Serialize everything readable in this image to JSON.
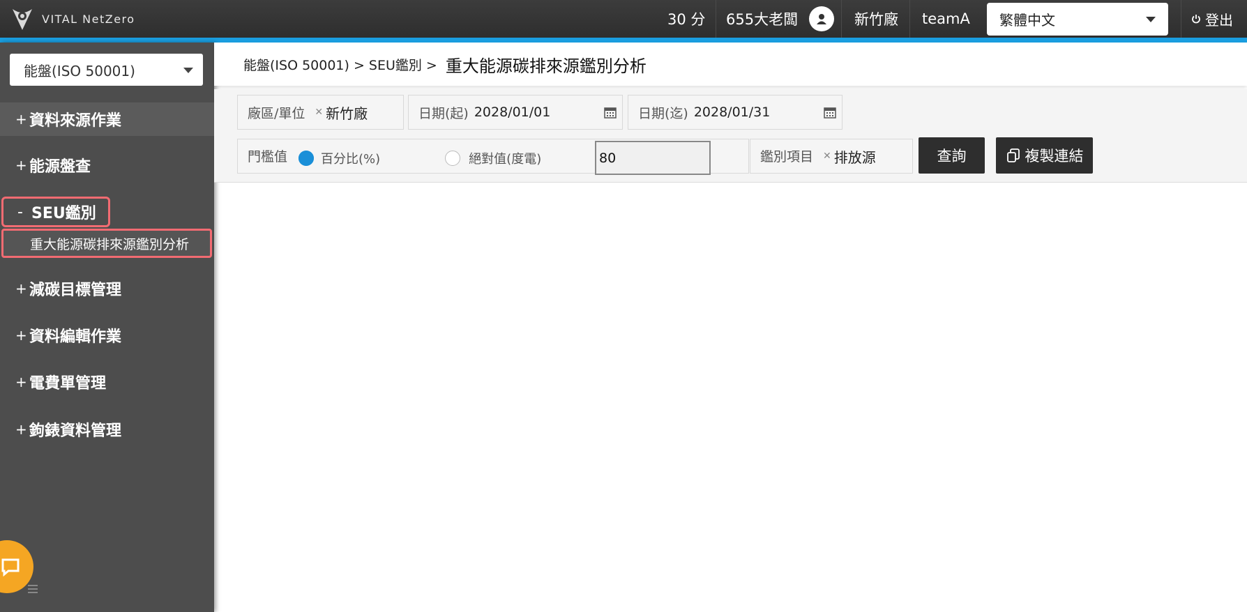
{
  "header": {
    "logo_text": "VITAL NetZero",
    "points": "30 分",
    "username": "655大老闆",
    "plant": "新竹廠",
    "team": "teamA",
    "language": "繁體中文",
    "logout_label": "登出"
  },
  "sidebar": {
    "module": "能盤(ISO 50001)",
    "items": [
      {
        "sign": "+",
        "label": "資料來源作業"
      },
      {
        "sign": "+",
        "label": "能源盤查"
      },
      {
        "sign": "-",
        "label": "SEU鑑別"
      },
      {
        "sign": "+",
        "label": "減碳目標管理"
      },
      {
        "sign": "+",
        "label": "資料編輯作業"
      },
      {
        "sign": "+",
        "label": "電費單管理"
      },
      {
        "sign": "+",
        "label": "鉤錶資料管理"
      }
    ],
    "sub_item": "重大能源碳排來源鑑別分析"
  },
  "breadcrumb": {
    "path": "能盤(ISO 50001) > SEU鑑別 >",
    "title": "重大能源碳排來源鑑別分析"
  },
  "filters": {
    "plant_label": "廠區/單位",
    "plant_value": "新竹廠",
    "date_start_label": "日期(起)",
    "date_start_value": "2028/01/01",
    "date_end_label": "日期(迄)",
    "date_end_value": "2028/01/31",
    "threshold_label": "門檻值",
    "radio_percent": "百分比(%)",
    "radio_absolute": "絕對值(度電)",
    "threshold_value": "80",
    "item_label": "鑑別項目",
    "item_value": "排放源",
    "query_label": "查詢",
    "copy_label": "複製連結"
  },
  "colors": {
    "accent": "#1a9ee0",
    "highlight": "#f26b72",
    "chat": "#f5a623"
  }
}
